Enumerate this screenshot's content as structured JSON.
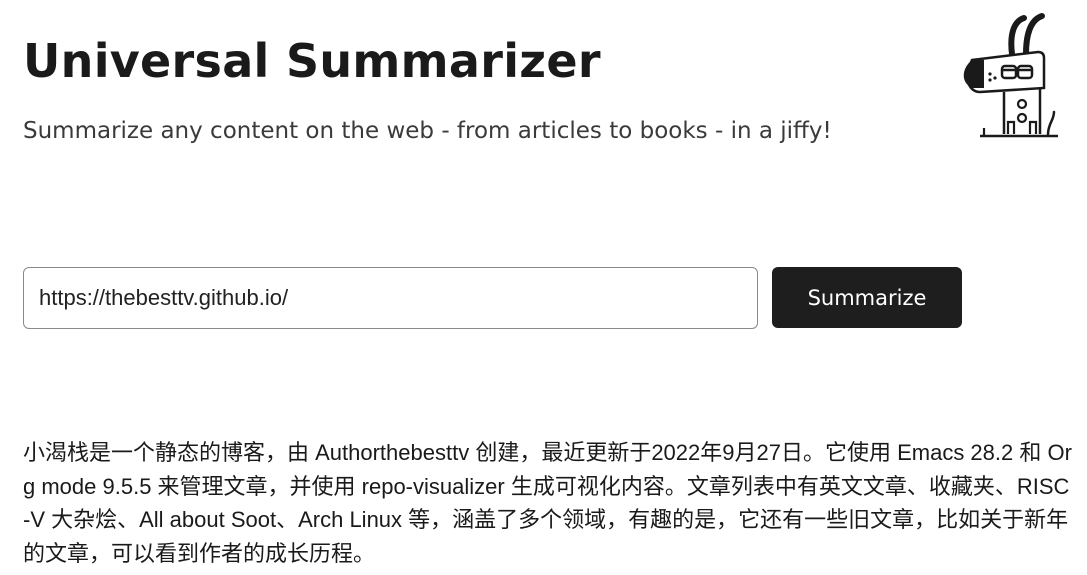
{
  "header": {
    "title": "Universal Summarizer",
    "subtitle": "Summarize any content on the web - from articles to books - in a jiffy!",
    "mascot": "dog-mascot-icon"
  },
  "form": {
    "url_value": "https://thebesttv.github.io/",
    "submit_label": "Summarize"
  },
  "result": {
    "summary": "小渴栈是一个静态的博客，由 Authorthebesttv 创建，最近更新于2022年9月27日。它使用 Emacs 28.2 和 Org mode 9.5.5 来管理文章，并使用 repo-visualizer 生成可视化内容。文章列表中有英文文章、收藏夹、RISC-V 大杂烩、All about Soot、Arch Linux 等，涵盖了多个领域，有趣的是，它还有一些旧文章，比如关于新年的文章，可以看到作者的成长历程。"
  },
  "colors": {
    "button_bg": "#1e1e1e",
    "button_text": "#ffffff",
    "input_border": "#8a8a8a",
    "text": "#1a1a1a"
  }
}
